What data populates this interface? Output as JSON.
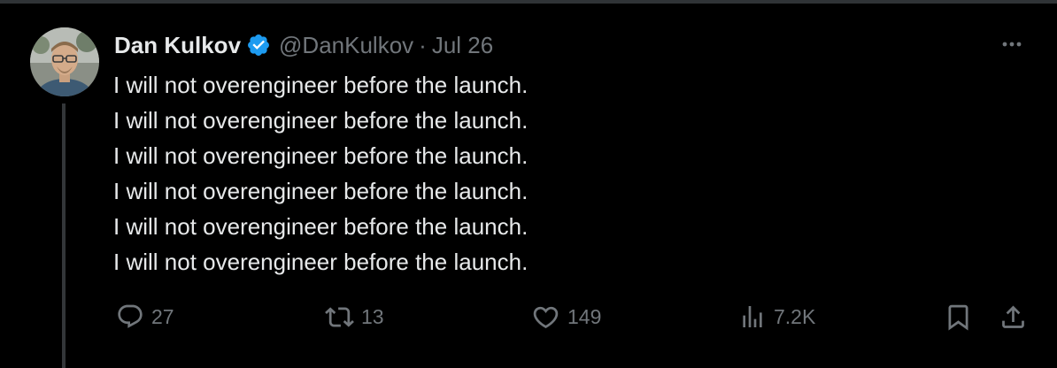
{
  "tweet": {
    "author": {
      "display_name": "Dan Kulkov",
      "handle": "@DanKulkov",
      "verified": true,
      "avatar_icon": "profile-photo"
    },
    "separator": "·",
    "date": "Jul 26",
    "more_icon": "more-horizontal-icon",
    "text_lines": [
      "I will not overengineer before the launch.",
      "I will not overengineer before the launch.",
      "I will not overengineer before the launch.",
      "I will not overengineer before the launch.",
      "I will not overengineer before the launch.",
      "I will not overengineer before the launch."
    ],
    "stats": {
      "replies": "27",
      "reposts": "13",
      "likes": "149",
      "views": "7.2K"
    }
  },
  "colors": {
    "background": "#000000",
    "primary_text": "#e7e9ea",
    "secondary_text": "#71767b",
    "verified_badge": "#1d9bf0",
    "divider": "#2f3336"
  }
}
